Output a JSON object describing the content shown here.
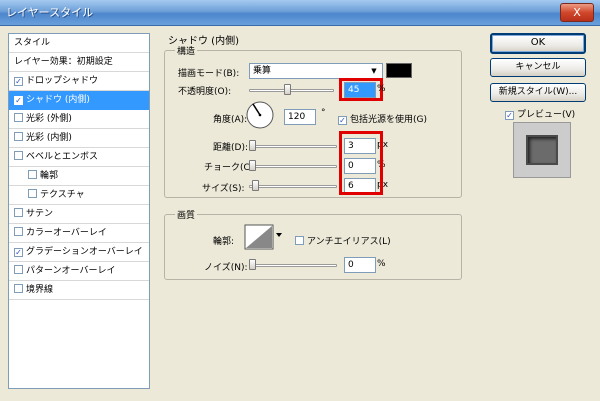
{
  "window": {
    "title": "レイヤースタイル",
    "close_glyph": "X"
  },
  "style_panel": {
    "header": "スタイル",
    "items": [
      {
        "label": "レイヤー効果：初期設定",
        "checkbox": false,
        "checked": false,
        "selected": false,
        "indent": false
      },
      {
        "label": "ドロップシャドウ",
        "checkbox": true,
        "checked": true,
        "selected": false,
        "indent": false
      },
      {
        "label": "シャドウ (内側)",
        "checkbox": true,
        "checked": true,
        "selected": true,
        "indent": false
      },
      {
        "label": "光彩 (外側)",
        "checkbox": true,
        "checked": false,
        "selected": false,
        "indent": false
      },
      {
        "label": "光彩 (内側)",
        "checkbox": true,
        "checked": false,
        "selected": false,
        "indent": false
      },
      {
        "label": "ベベルとエンボス",
        "checkbox": true,
        "checked": false,
        "selected": false,
        "indent": false
      },
      {
        "label": "輪郭",
        "checkbox": true,
        "checked": false,
        "selected": false,
        "indent": true
      },
      {
        "label": "テクスチャ",
        "checkbox": true,
        "checked": false,
        "selected": false,
        "indent": true
      },
      {
        "label": "サテン",
        "checkbox": true,
        "checked": false,
        "selected": false,
        "indent": false
      },
      {
        "label": "カラーオーバーレイ",
        "checkbox": true,
        "checked": false,
        "selected": false,
        "indent": false
      },
      {
        "label": "グラデーションオーバーレイ",
        "checkbox": true,
        "checked": true,
        "selected": false,
        "indent": false
      },
      {
        "label": "パターンオーバーレイ",
        "checkbox": true,
        "checked": false,
        "selected": false,
        "indent": false
      },
      {
        "label": "境界線",
        "checkbox": true,
        "checked": false,
        "selected": false,
        "indent": false
      }
    ]
  },
  "inner_shadow": {
    "section_title": "シャドウ (内側)",
    "structure": {
      "title": "構造",
      "blend_mode_label": "描画モード(B):",
      "blend_mode_value": "乗算",
      "blend_color": "#000000",
      "opacity_label": "不透明度(O):",
      "opacity_value": "45",
      "opacity_unit": "%",
      "angle_label": "角度(A):",
      "angle_value": "120",
      "angle_unit": "°",
      "global_light_label": "包括光源を使用(G)",
      "global_light_checked": true,
      "distance_label": "距離(D):",
      "distance_value": "3",
      "distance_unit": "px",
      "choke_label": "チョーク(C):",
      "choke_value": "0",
      "choke_unit": "%",
      "size_label": "サイズ(S):",
      "size_value": "6",
      "size_unit": "px"
    },
    "quality": {
      "title": "画質",
      "contour_label": "輪郭:",
      "antialias_label": "アンチエイリアス(L)",
      "antialias_checked": false,
      "noise_label": "ノイズ(N):",
      "noise_value": "0",
      "noise_unit": "%"
    }
  },
  "buttons": {
    "ok": "OK",
    "cancel": "キャンセル",
    "new_style": "新規スタイル(W)...",
    "preview_label": "プレビュー(V)",
    "preview_checked": true
  },
  "highlight_color": "#e00000",
  "selection_color": "#3399ff"
}
